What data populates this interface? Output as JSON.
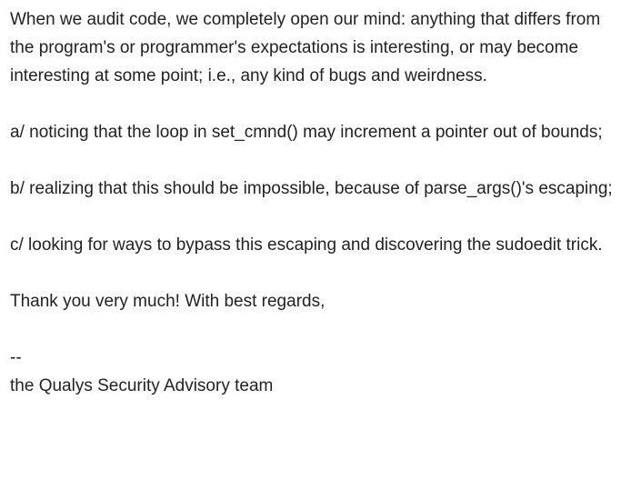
{
  "message": {
    "intro": "When we audit code, we completely open our mind: anything that differs from the program's or programmer's expectations is interesting, or may become interesting at some point; i.e., any kind of bugs and weirdness.",
    "point_a": "a/ noticing that the loop in set_cmnd() may increment a pointer out of bounds;",
    "point_b": "b/ realizing that this should be impossible, because of parse_args()'s escaping;",
    "point_c": "c/ looking for ways to bypass this escaping and discovering the sudoedit trick.",
    "closing": "Thank you very much! With best regards,",
    "signature_separator": "--",
    "signature": "the Qualys Security Advisory team"
  }
}
